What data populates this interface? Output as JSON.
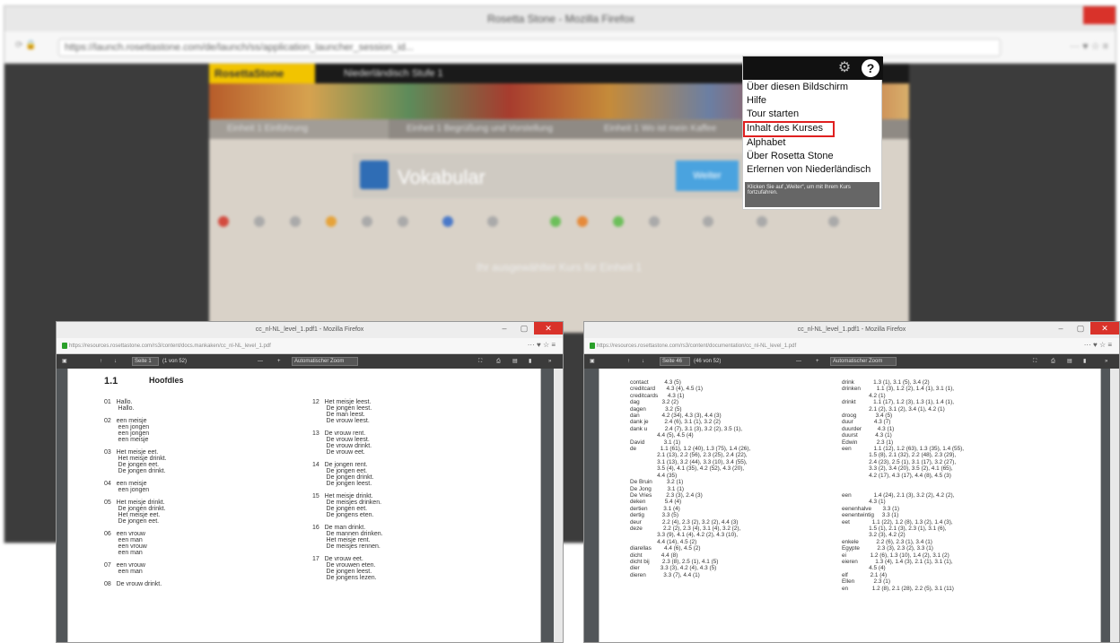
{
  "main_window": {
    "title": "Rosetta Stone - Mozilla Firefox",
    "url": "https://launch.rosettastone.com/de/launch/ss/application_launcher_session_id...",
    "app": {
      "logo": "RosettaStone",
      "course": "Niederländisch Stufe 1",
      "tabs": [
        "Einheit 1 Einführung",
        "Einheit 1 Begrüßung und Vorstellung",
        "Einheit 1 Wo ist mein Kaffee"
      ],
      "vocab_title": "Vokabular",
      "vocab_button": "Weiter",
      "notice": "Ihr ausgewählter Kurs für Einheit 1"
    }
  },
  "menu": {
    "items": [
      "Über diesen Bildschirm",
      "Hilfe",
      "Tour starten",
      "Inhalt des Kurses",
      "Alphabet",
      "Über Rosetta Stone",
      "Erlernen von Niederländisch"
    ],
    "hint": "Klicken Sie auf „Weiter“, um mit Ihrem Kurs fortzufahren.",
    "highlight_color": "#e02020"
  },
  "pdf_left": {
    "title": "cc_nl-NL_level_1.pdf1 - Mozilla Firefox",
    "url": "https://resources.rosettastone.com/rs3/content/docs.mankaken/cc_nl-NL_level_1.pdf",
    "page_field": "Seite 1",
    "page_info": "(1 von 52)",
    "zoom": "Automatischer Zoom",
    "section_number": "1.1",
    "section_title": "Hoofdles",
    "col1": "01   Hallo.\n        Hallo.\n\n02   een meisje\n        een jongen\n        een jongen\n        een meisje\n\n03   Het meisje eet.\n        Het meisje drinkt.\n        De jongen eet.\n        De jongen drinkt.\n\n04   een meisje\n        een jongen\n\n05   Het meisje drinkt.\n        De jongen drinkt.\n        Het meisje eet.\n        De jongen eet.\n\n06   een vrouw\n        een man\n        een vrouw\n        een man\n\n07   een vrouw\n        een man\n\n08   De vrouw drinkt.",
    "col2": "12   Het meisje leest.\n        De jongen leest.\n        De man leest.\n        De vrouw leest.\n\n13   De vrouw rent.\n        De vrouw leest.\n        De vrouw drinkt.\n        De vrouw eet.\n\n14   De jongen rent.\n        De jongen eet.\n        De jongen drinkt.\n        De jongen leest.\n\n15   Het meisje drinkt.\n        De meisjes drinken.\n        De jongen eet.\n        De jongens eten.\n\n16   De man drinkt.\n        De mannen drinken.\n        Het meisje rent.\n        De meisjes rennen.\n\n17   De vrouw eet.\n        De vrouwen eten.\n        De jongen leest.\n        De jongens lezen."
  },
  "pdf_right": {
    "title": "cc_nl-NL_level_1.pdf1 - Mozilla Firefox",
    "url": "https://resources.rosettastone.com/rs3/content/documentation/cc_nl-NL_level_1.pdf",
    "page_field": "Seite 46",
    "page_info": "(46 von 52)",
    "zoom": "Automatischer Zoom",
    "col1": "contact          4.3 (5)\ncreditcard       4.3 (4), 4.5 (1)\ncreditcards      4.3 (1)\ndag              3.2 (2)\ndagen            3.2 (5)\ndan              4.2 (34), 4.3 (3), 4.4 (3)\ndank je          2.4 (6), 3.1 (1), 3.2 (2)\ndank u           2.4 (7), 3.1 (3), 3.2 (2), 3.5 (1),\n                 4.4 (5), 4.5 (4)\nDavid            3.1 (1)\nde               1.1 (61), 1.2 (40), 1.3 (75), 1.4 (26),\n                 2.1 (13), 2.2 (56), 2.3 (25), 2.4 (22),\n                 3.1 (13), 3.2 (44), 3.3 (10), 3.4 (55),\n                 3.5 (4), 4.1 (35), 4.2 (52), 4.3 (20),\n                 4.4 (35)\nDe Bruin         3.2 (1)\nDe Jong          3.1 (1)\nDe Vries         2.3 (3), 2.4 (3)\ndeken            5.4 (4)\ndertien          3.1 (4)\ndertig           3.3 (5)\ndeur             2.2 (4), 2.3 (2), 3.2 (2), 4.4 (3)\ndeze             2.2 (2), 2.3 (4), 3.1 (4), 3.2 (2),\n                 3.3 (9), 4.1 (4), 4.2 (2), 4.3 (10),\n                 4.4 (14), 4.5 (2)\ndiarellas        4.4 (6), 4.5 (2)\ndicht            4.4 (8)\ndicht bij        2.3 (8), 2.5 (1), 4.1 (5)\ndier             3.3 (3), 4.2 (4), 4.3 (5)\ndieren           3.3 (7), 4.4 (1)",
    "col2": "drink            1.3 (1), 3.1 (5), 3.4 (2)\ndrinken          1.1 (3), 1.2 (2), 1.4 (1), 3.1 (1),\n                 4.2 (1)\ndrinkt           1.1 (17), 1.2 (3), 1.3 (1), 1.4 (1),\n                 2.1 (2), 3.1 (2), 3.4 (1), 4.2 (1)\ndroog            3.4 (5)\nduur             4.3 (7)\nduurder          4.3 (1)\nduurst           4.3 (1)\nEdwin            2.3 (1)\neen              1.1 (12), 1.2 (63), 1.3 (35), 1.4 (55),\n                 1.5 (8), 2.1 (32), 2.2 (48), 2.3 (29),\n                 2.4 (23), 2.5 (1), 3.1 (17), 3.2 (27),\n                 3.3 (2), 3.4 (20), 3.5 (2), 4.1 (65),\n                 4.2 (17), 4.3 (17), 4.4 (8), 4.5 (3)\n\n\neen              1.4 (24), 2.1 (3), 3.2 (2), 4.2 (2),\n                 4.3 (1)\neenenhalve       3.3 (1)\neenentwintig     3.3 (1)\neet              1.1 (22), 1.2 (8), 1.3 (2), 1.4 (3),\n                 1.5 (1), 2.1 (3), 2.3 (1), 3.1 (6),\n                 3.2 (3), 4.2 (2)\nenkele           2.2 (6), 2.3 (1), 3.4 (1)\nEgypte           2.3 (3), 2.3 (2), 3.3 (1)\nei               1.2 (6), 1.3 (10), 1.4 (2), 3.1 (2)\neieren           1.3 (4), 1.4 (3), 2.1 (1), 3.1 (1),\n                 4.5 (4)\nelf              2.1 (4)\nEllen            2.3 (1)\nen               1.2 (8), 2.1 (28), 2.2 (5), 3.1 (11)"
  }
}
